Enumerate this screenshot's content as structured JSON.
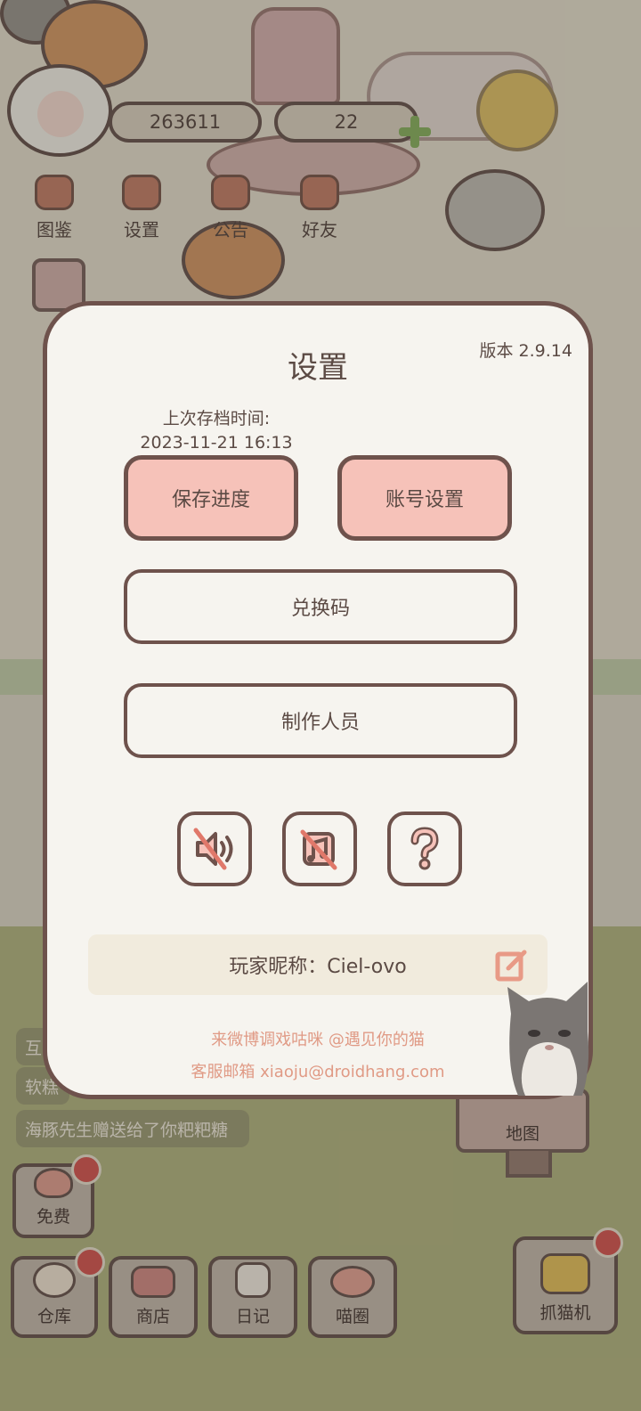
{
  "status": {
    "coins": "263611",
    "gems": "22"
  },
  "top_nav": [
    {
      "label": "图鉴",
      "icon": "book-cat-icon"
    },
    {
      "label": "设置",
      "icon": "gear-icon"
    },
    {
      "label": "公告",
      "icon": "gift-icon"
    },
    {
      "label": "好友",
      "icon": "friends-icon"
    }
  ],
  "chat": [
    {
      "text": "互"
    },
    {
      "text": "软糕"
    },
    {
      "text": "海豚先生赠送给了你粑粑糖"
    }
  ],
  "side_buttons": {
    "free_label": "免费",
    "map_label": "地图",
    "claw_label": "抓猫机"
  },
  "bottom_bar": [
    {
      "label": "仓库",
      "icon": "storage-icon"
    },
    {
      "label": "商店",
      "icon": "shop-icon"
    },
    {
      "label": "日记",
      "icon": "diary-icon"
    },
    {
      "label": "喵圈",
      "icon": "cat-planet-icon"
    }
  ],
  "dialog": {
    "title": "设置",
    "version": "版本 2.9.14",
    "save_time_label": "上次存档时间:",
    "save_time_value": "2023-11-21 16:13",
    "save_button": "保存进度",
    "account_button": "账号设置",
    "redeem_button": "兑换码",
    "credits_button": "制作人员",
    "toggles": [
      {
        "icon": "sound-muted-icon"
      },
      {
        "icon": "music-muted-icon"
      },
      {
        "icon": "help-icon"
      }
    ],
    "nickname": "玩家昵称：Ciel-ovo",
    "footer_weibo": "来微博调戏咕咪 @遇见你的猫",
    "footer_email": "客服邮箱 xiaoju@droidhang.com"
  },
  "colors": {
    "accent_pink": "#f6c2b9",
    "border_brown": "#6e524c",
    "footer_text": "#e09a85",
    "badge_red": "#c94b47"
  }
}
